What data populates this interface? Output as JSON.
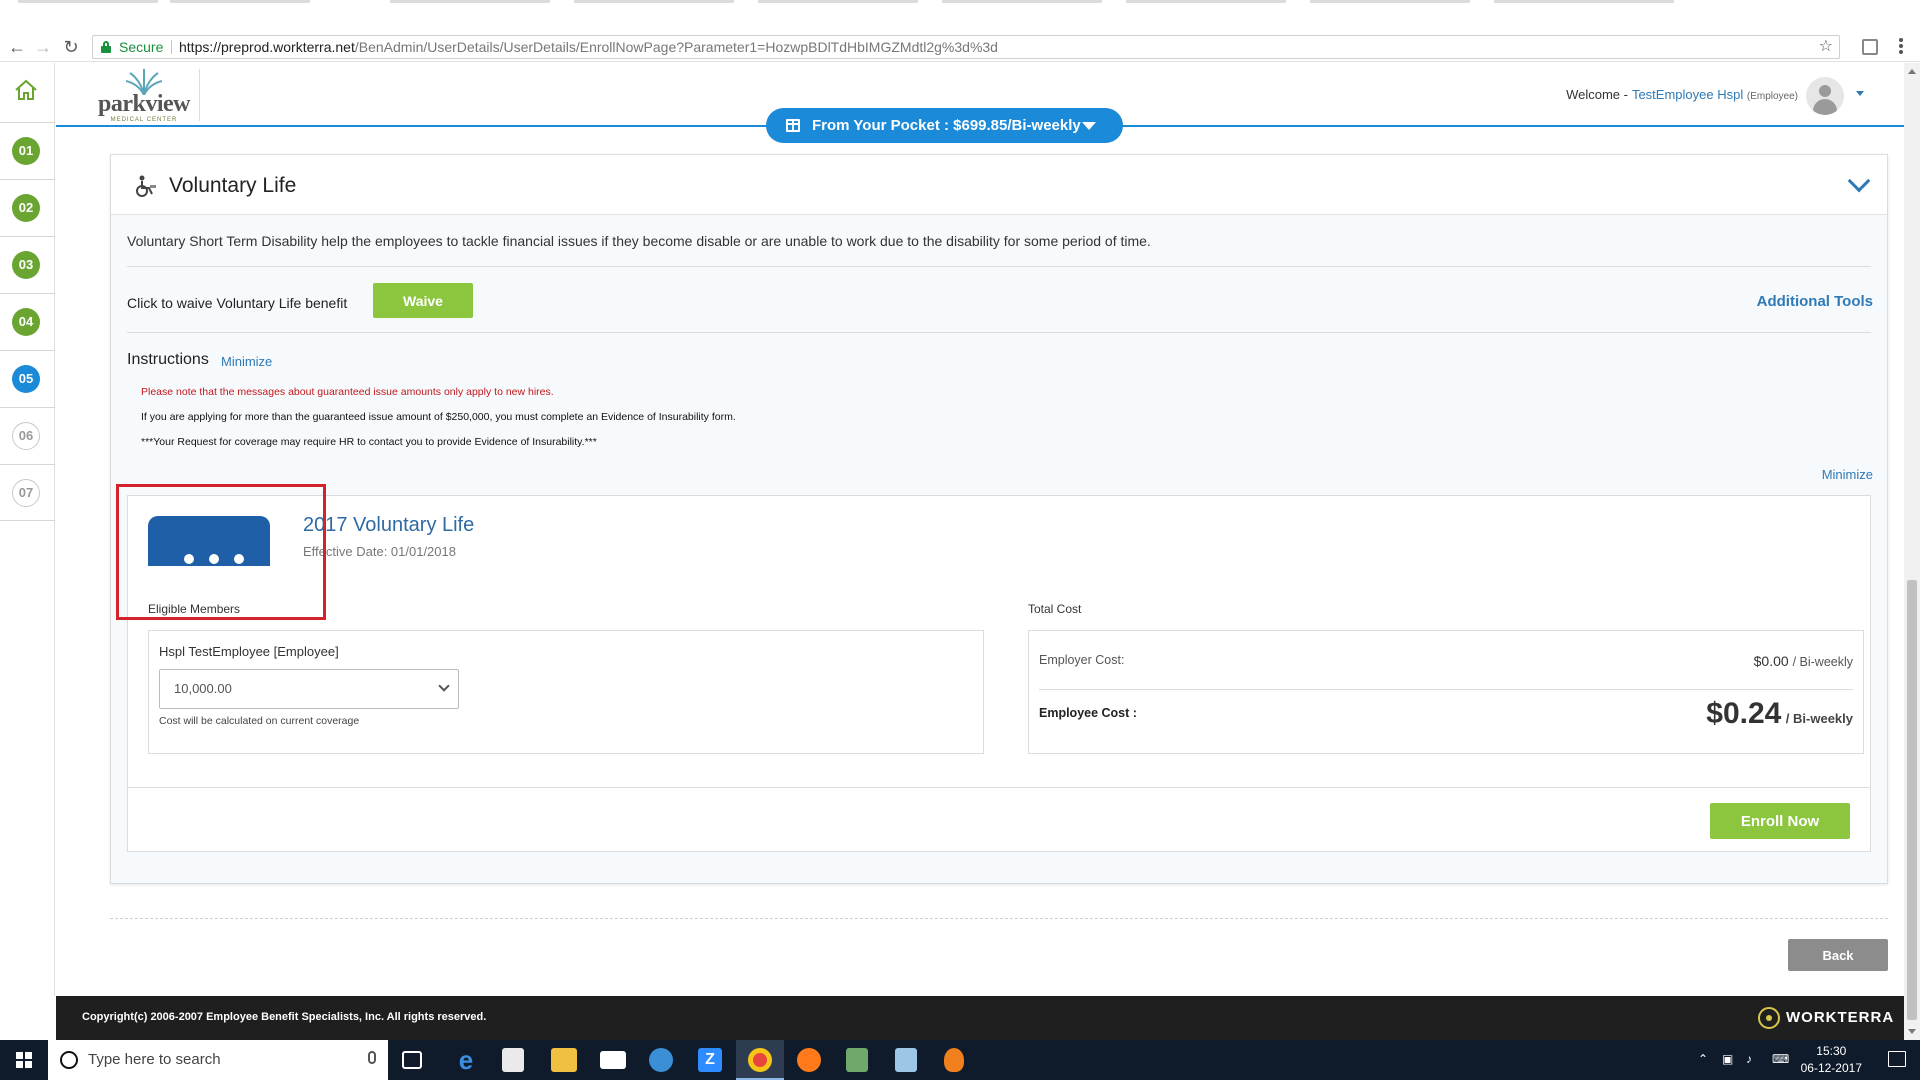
{
  "browser": {
    "secure_label": "Secure",
    "url_host": "https://preprod.workterra.net",
    "url_path": "/BenAdmin/UserDetails/UserDetails/EnrollNowPage?Parameter1=HozwpBDlTdHbIMGZMdtl2g%3d%3d"
  },
  "sidebar": {
    "steps": [
      {
        "label": "01",
        "state": "done"
      },
      {
        "label": "02",
        "state": "done"
      },
      {
        "label": "03",
        "state": "done"
      },
      {
        "label": "04",
        "state": "done"
      },
      {
        "label": "05",
        "state": "active"
      },
      {
        "label": "06",
        "state": "todo"
      },
      {
        "label": "07",
        "state": "todo"
      }
    ]
  },
  "header": {
    "logo_text": "parkview",
    "logo_sub": "MEDICAL CENTER",
    "welcome": "Welcome -",
    "user_name": "TestEmployee Hspl",
    "user_role": "(Employee)",
    "pocket": "From Your Pocket : $699.85/Bi-weekly"
  },
  "panel": {
    "title": "Voluntary Life",
    "description": "Voluntary Short Term Disability help the employees to tackle financial issues if they become disable or are unable to work due to the disability for some period of time.",
    "waive_label": "Click to waive Voluntary Life benefit",
    "waive_button": "Waive",
    "additional_tools": "Additional Tools",
    "instructions_heading": "Instructions",
    "instructions_minimize": "Minimize",
    "instructions": [
      "Please note that the messages about guaranteed issue amounts only apply to new hires.",
      "If you are applying for more than the guaranteed issue amount of $250,000, you must complete an Evidence of Insurability form.",
      "***Your Request for coverage may require HR to contact you to provide Evidence of Insurability.***"
    ],
    "minimize2": "Minimize"
  },
  "plan": {
    "name": "2017 Voluntary Life",
    "effective_date": "Effective Date: 01/01/2018",
    "eligible_heading": "Eligible Members",
    "member": "Hspl TestEmployee [Employee]",
    "coverage_selected": "10,000.00",
    "coverage_note": "Cost will be calculated on current coverage",
    "total_cost_heading": "Total Cost",
    "employer_cost_label": "Employer Cost:",
    "employer_cost_value": "$0.00",
    "employer_cost_period": "/ Bi-weekly",
    "employee_cost_label": "Employee Cost :",
    "employee_cost_value": "$0.24",
    "employee_cost_period": "/ Bi-weekly",
    "enroll_button": "Enroll Now"
  },
  "back_button": "Back",
  "footer": {
    "copyright": "Copyright(c) 2006-2007 Employee Benefit Specialists, Inc. All rights reserved.",
    "brand": "WORKTERRA"
  },
  "taskbar": {
    "search_placeholder": "Type here to search",
    "time": "15:30",
    "date": "06-12-2017"
  },
  "colors": {
    "accent_blue": "#1b8ad8",
    "action_green": "#8cc63f",
    "step_done": "#6aa532",
    "highlight_red": "#d2232a"
  }
}
